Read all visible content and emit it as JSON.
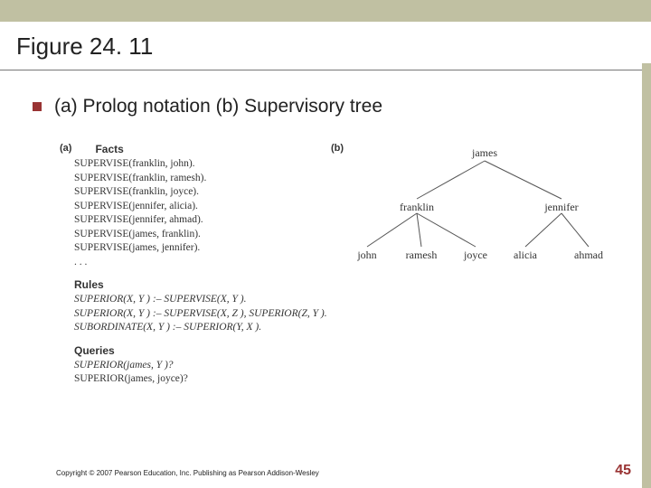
{
  "slide": {
    "title": "Figure 24. 11",
    "bullet": "(a) Prolog notation (b) Supervisory tree",
    "copyright": "Copyright © 2007 Pearson Education, Inc. Publishing as Pearson Addison-Wesley",
    "page": "45"
  },
  "figure": {
    "a_label": "(a)",
    "b_label": "(b)",
    "facts_head": "Facts",
    "rules_head": "Rules",
    "queries_head": "Queries",
    "facts": [
      "SUPERVISE(franklin, john).",
      "SUPERVISE(franklin, ramesh).",
      "SUPERVISE(franklin, joyce).",
      "SUPERVISE(jennifer, alicia).",
      "SUPERVISE(jennifer, ahmad).",
      "SUPERVISE(james, franklin).",
      "SUPERVISE(james, jennifer).",
      ". . ."
    ],
    "rules": [
      "SUPERIOR(X, Y ) :– SUPERVISE(X, Y ).",
      "SUPERIOR(X, Y ) :– SUPERVISE(X, Z ), SUPERIOR(Z, Y ).",
      "SUBORDINATE(X, Y ) :– SUPERIOR(Y, X )."
    ],
    "queries": [
      "SUPERIOR(james, Y )?",
      "SUPERIOR(james, joyce)?"
    ],
    "tree": {
      "root": "james",
      "level1": [
        "franklin",
        "jennifer"
      ],
      "level2": [
        "john",
        "ramesh",
        "joyce",
        "alicia",
        "ahmad"
      ]
    }
  }
}
